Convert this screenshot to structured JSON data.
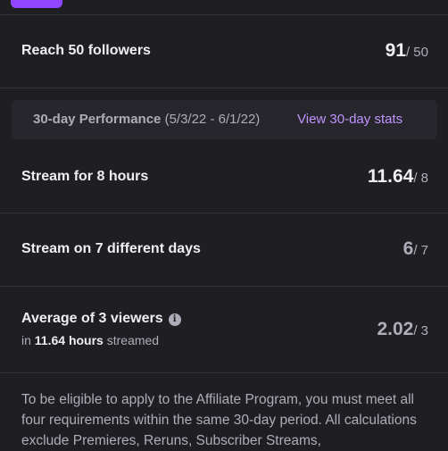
{
  "colors": {
    "background": "#1f1f23",
    "accent": "#9147ff",
    "link": "#bf94ff",
    "text_primary": "#efeff1",
    "text_muted": "#adadb8"
  },
  "requirements_top": {
    "followers": {
      "label": "Reach 50 followers",
      "current": "91",
      "target": "/ 50"
    }
  },
  "performance": {
    "title": "30-day Performance",
    "date_range": "(5/3/22 - 6/1/22)",
    "link_label": "View 30-day stats"
  },
  "requirements": {
    "hours": {
      "label": "Stream for 8 hours",
      "current": "11.64",
      "target": "/ 8"
    },
    "days": {
      "label": "Stream on 7 different days",
      "current": "6",
      "target": "/ 7"
    },
    "viewers": {
      "label": "Average of 3 viewers",
      "info_icon": "info-icon",
      "sub_prefix": "in",
      "sub_hours": "11.64 hours",
      "sub_suffix": "streamed",
      "current": "2.02",
      "target": "/ 3"
    }
  },
  "footnote": "To be eligible to apply to the Affiliate Program, you must meet all four requirements within the same 30-day period. All calculations exclude Premieres, Reruns, Subscriber Streams,"
}
